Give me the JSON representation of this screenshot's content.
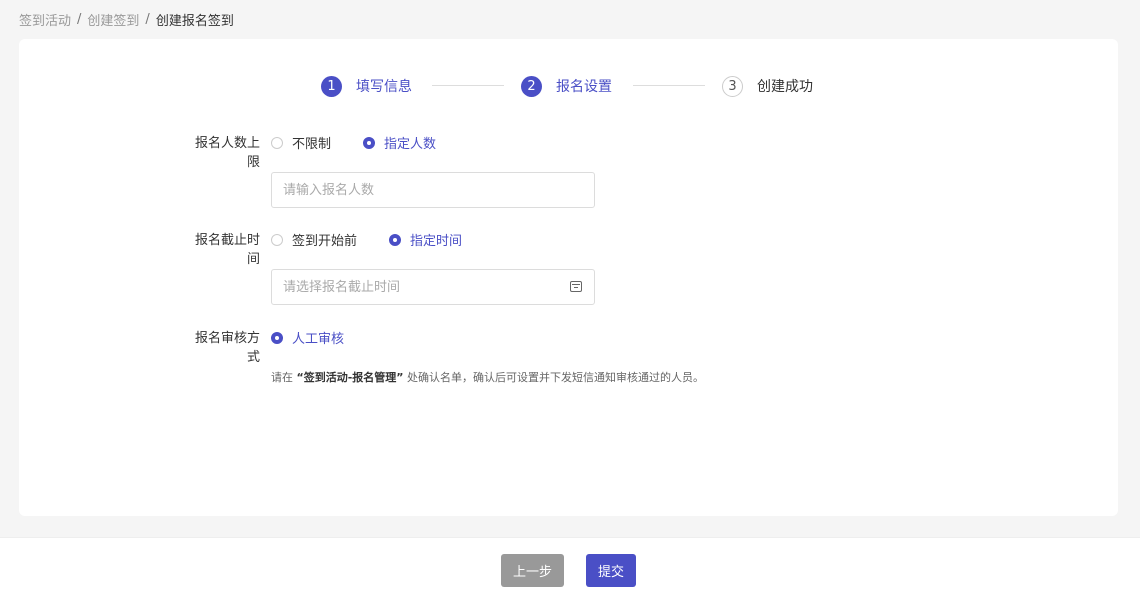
{
  "breadcrumb": {
    "items": [
      "签到活动",
      "创建签到",
      "创建报名签到"
    ],
    "separator": "/"
  },
  "steps": [
    {
      "number": "1",
      "label": "填写信息",
      "state": "done"
    },
    {
      "number": "2",
      "label": "报名设置",
      "state": "active"
    },
    {
      "number": "3",
      "label": "创建成功",
      "state": "todo"
    }
  ],
  "form": {
    "limit": {
      "label": "报名人数上限",
      "options": [
        "不限制",
        "指定人数"
      ],
      "selected": "指定人数",
      "input_placeholder": "请输入报名人数",
      "input_value": ""
    },
    "deadline": {
      "label": "报名截止时间",
      "options": [
        "签到开始前",
        "指定时间"
      ],
      "selected": "指定时间",
      "input_placeholder": "请选择报名截止时间",
      "input_value": ""
    },
    "review": {
      "label": "报名审核方式",
      "options": [
        "人工审核"
      ],
      "selected": "人工审核",
      "hint_prefix": "请在",
      "hint_bold": "“签到活动-报名管理”",
      "hint_suffix": "处确认名单，确认后可设置并下发短信通知审核通过的人员。"
    }
  },
  "footer": {
    "prev_label": "上一步",
    "submit_label": "提交"
  },
  "colors": {
    "accent": "#4a4fc6",
    "disabled_button": "#999999"
  }
}
